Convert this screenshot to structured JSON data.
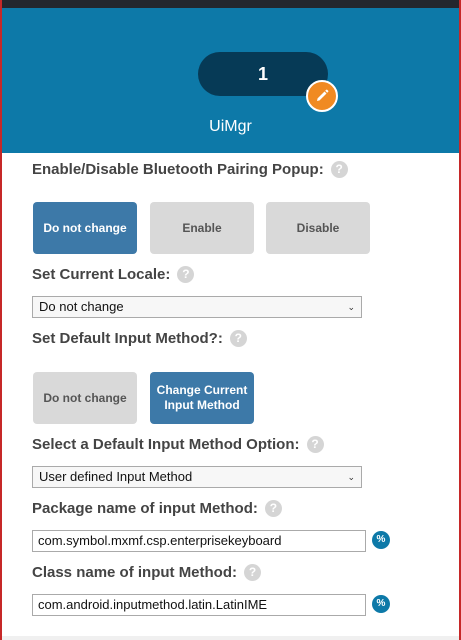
{
  "header": {
    "step_number": "1",
    "title": "UiMgr",
    "edit_icon": "pencil-icon",
    "background_color": "#0d79a8"
  },
  "bluetooth_popup": {
    "label": "Enable/Disable Bluetooth Pairing Popup:",
    "help": "?",
    "options": [
      "Do not change",
      "Enable",
      "Disable"
    ],
    "selected": "Do not change"
  },
  "current_locale": {
    "label": "Set Current Locale:",
    "help": "?",
    "value": "Do not change"
  },
  "default_input_method": {
    "label": "Set Default Input Method?:",
    "help": "?",
    "options": [
      "Do not change",
      "Change Current Input Method"
    ],
    "selected": "Change Current Input Method"
  },
  "input_method_option": {
    "label": "Select a Default Input Method Option:",
    "help": "?",
    "value": "User defined Input Method"
  },
  "package_name": {
    "label": "Package name of input Method:",
    "help": "?",
    "value": "com.symbol.mxmf.csp.enterprisekeyboard",
    "variable_button": "%"
  },
  "class_name": {
    "label": "Class name of input Method:",
    "help": "?",
    "value": "com.android.inputmethod.latin.LatinIME",
    "variable_button": "%"
  },
  "colors": {
    "selected_button": "#3d79a8",
    "unselected_button": "#d9d9d9",
    "edit_badge": "#f08a22"
  }
}
